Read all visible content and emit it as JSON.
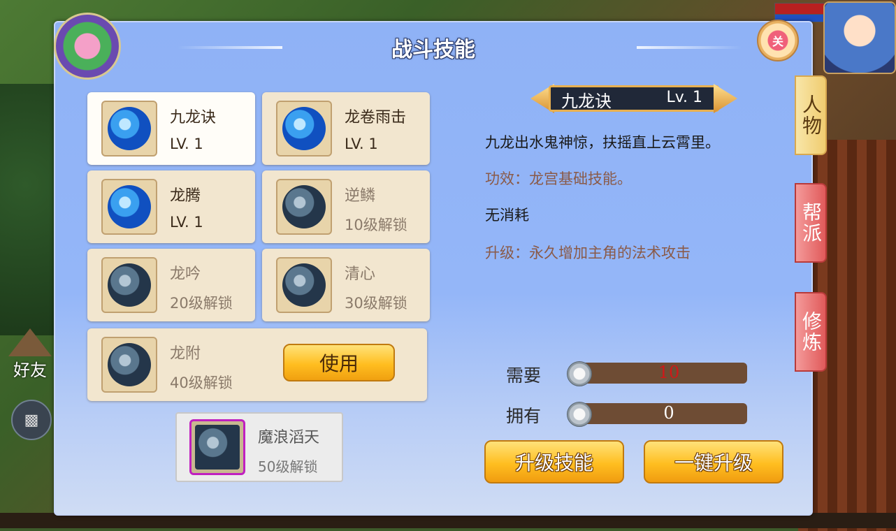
{
  "panel": {
    "title": "战斗技能",
    "close_label": "关"
  },
  "skills": [
    {
      "name": "九龙诀",
      "level": "LV. 1"
    },
    {
      "name": "龙卷雨击",
      "level": "LV. 1"
    },
    {
      "name": "龙腾",
      "level": "LV. 1"
    },
    {
      "name": "逆鳞",
      "level": "10级解锁"
    },
    {
      "name": "龙吟",
      "level": "20级解锁"
    },
    {
      "name": "清心",
      "level": "30级解锁"
    },
    {
      "name": "龙附",
      "level": "40级解锁"
    }
  ],
  "use_button_label": "使用",
  "ultimate": {
    "name": "魔浪滔天",
    "level": "50级解锁"
  },
  "detail": {
    "name": "九龙诀",
    "level": "Lv. 1",
    "description": "九龙出水鬼神惊，扶摇直上云霄里。",
    "effect": "功效：龙宫基础技能。",
    "cost": "无消耗",
    "upgrade": "升级：永久增加主角的法术攻击"
  },
  "resources": {
    "need_label": "需要",
    "need_value": "10",
    "own_label": "拥有",
    "own_value": "0"
  },
  "buttons": {
    "upgrade": "升级技能",
    "one_click": "一键升级"
  },
  "side_tabs": [
    {
      "label": "人物",
      "active": true
    },
    {
      "label": "帮派",
      "active": false
    },
    {
      "label": "修炼",
      "active": false
    }
  ],
  "hud": {
    "friend_label": "好友"
  },
  "colors": {
    "panel_bg": "#94b6f8",
    "card_bg": "#f2e6cf",
    "button_gold": "#ffbe20",
    "tab_active": "#f0cc70",
    "tab_inactive": "#e05a5a",
    "need_value": "#d01818"
  }
}
